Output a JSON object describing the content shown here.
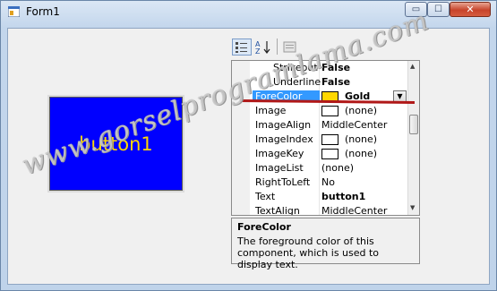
{
  "window": {
    "title": "Form1",
    "buttons": {
      "minimize": "▭",
      "maximize": "☐",
      "close": "✕"
    }
  },
  "form": {
    "button_text": "button1",
    "button_backcolor": "#0000FF",
    "button_forecolor": "#FFD700"
  },
  "properties": {
    "rows": [
      {
        "name": "Strikeout",
        "value": "False",
        "bold": true,
        "indent": true
      },
      {
        "name": "Underline",
        "value": "False",
        "bold": true,
        "indent": true
      },
      {
        "name": "ForeColor",
        "value": "Gold",
        "bold": true,
        "selected": true,
        "swatch": "#FFD700"
      },
      {
        "name": "Image",
        "value": "(none)",
        "swatch": "#FFFFFF"
      },
      {
        "name": "ImageAlign",
        "value": "MiddleCenter"
      },
      {
        "name": "ImageIndex",
        "value": "(none)",
        "swatch": "#FFFFFF"
      },
      {
        "name": "ImageKey",
        "value": "(none)",
        "swatch": "#FFFFFF"
      },
      {
        "name": "ImageList",
        "value": "(none)"
      },
      {
        "name": "RightToLeft",
        "value": "No"
      },
      {
        "name": "Text",
        "value": "button1",
        "bold": true
      },
      {
        "name": "TextAlign",
        "value": "MiddleCenter"
      }
    ],
    "description": {
      "title": "ForeColor",
      "text": "The foreground color of this component, which is used to display text."
    }
  },
  "watermark": "www.gorselprogramlama.com",
  "accent_colors": {
    "selection": "#3399FF",
    "annotation": "#B01818",
    "gold": "#FFD700"
  }
}
